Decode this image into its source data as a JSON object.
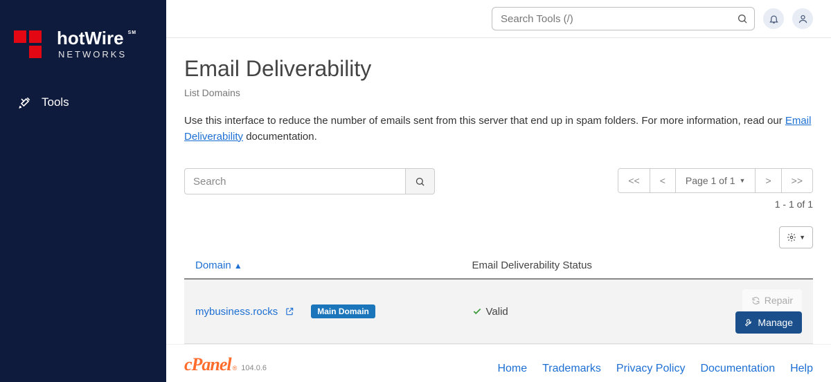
{
  "sidebar": {
    "brand1": "hot",
    "brand2": "Wire",
    "sm": "SM",
    "networks": "NETWORKS",
    "nav": {
      "tools": "Tools"
    }
  },
  "header": {
    "search_placeholder": "Search Tools (/)"
  },
  "page": {
    "title": "Email Deliverability",
    "subtitle": "List Domains",
    "desc_pre": "Use this interface to reduce the number of emails sent from this server that end up in spam folders. For more information, read our ",
    "desc_link": "Email Deliverability",
    "desc_post": " documentation."
  },
  "controls": {
    "search_placeholder": "Search",
    "pager": {
      "first": "<<",
      "prev": "<",
      "label": "Page 1 of 1",
      "next": ">",
      "last": ">>"
    },
    "count": "1 - 1 of 1"
  },
  "table": {
    "col_domain": "Domain",
    "col_status": "Email Deliverability Status",
    "row": {
      "domain": "mybusiness.rocks",
      "badge": "Main Domain",
      "status": "Valid",
      "repair": "Repair",
      "manage": "Manage"
    }
  },
  "footer": {
    "brand": "cPanel",
    "version": "104.0.6",
    "links": {
      "home": "Home",
      "trademarks": "Trademarks",
      "privacy": "Privacy Policy",
      "docs": "Documentation",
      "help": "Help"
    }
  }
}
